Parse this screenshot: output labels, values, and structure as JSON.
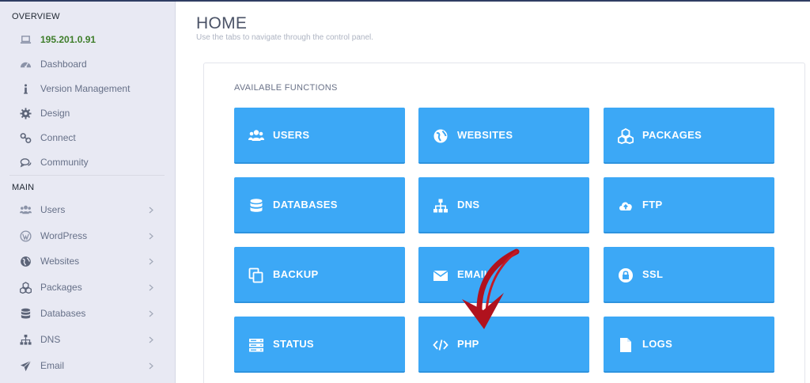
{
  "sidebar": {
    "overview_heading": "OVERVIEW",
    "main_heading": "MAIN",
    "overview_items": [
      {
        "label": "195.201.0.91",
        "icon": "laptop-icon"
      },
      {
        "label": "Dashboard",
        "icon": "dashboard-icon"
      },
      {
        "label": "Version Management",
        "icon": "info-icon"
      },
      {
        "label": "Design",
        "icon": "gear-icon"
      },
      {
        "label": "Connect",
        "icon": "link-icon"
      },
      {
        "label": "Community",
        "icon": "comments-icon"
      }
    ],
    "main_items": [
      {
        "label": "Users",
        "icon": "users-icon"
      },
      {
        "label": "WordPress",
        "icon": "wordpress-icon"
      },
      {
        "label": "Websites",
        "icon": "globe-icon"
      },
      {
        "label": "Packages",
        "icon": "cubes-icon"
      },
      {
        "label": "Databases",
        "icon": "database-icon"
      },
      {
        "label": "DNS",
        "icon": "sitemap-icon"
      },
      {
        "label": "Email",
        "icon": "paper-plane-icon"
      }
    ]
  },
  "page": {
    "title": "HOME",
    "subtitle": "Use the tabs to navigate through the control panel."
  },
  "functions": {
    "heading": "AVAILABLE FUNCTIONS",
    "tiles": [
      {
        "label": "USERS",
        "icon": "users-icon"
      },
      {
        "label": "WEBSITES",
        "icon": "globe-icon"
      },
      {
        "label": "PACKAGES",
        "icon": "cubes-icon"
      },
      {
        "label": "DATABASES",
        "icon": "database-icon"
      },
      {
        "label": "DNS",
        "icon": "sitemap-icon"
      },
      {
        "label": "FTP",
        "icon": "cloud-upload-icon"
      },
      {
        "label": "BACKUP",
        "icon": "copy-icon"
      },
      {
        "label": "EMAIL",
        "icon": "envelope-icon"
      },
      {
        "label": "SSL",
        "icon": "lock-icon"
      },
      {
        "label": "STATUS",
        "icon": "server-icon"
      },
      {
        "label": "PHP",
        "icon": "code-icon"
      },
      {
        "label": "LOGS",
        "icon": "file-icon"
      }
    ]
  },
  "colors": {
    "tile": "#3ca8f6",
    "sidebar": "#e8e9f3",
    "ip_text": "#3e7d2a",
    "annotation_arrow": "#b0121e"
  }
}
